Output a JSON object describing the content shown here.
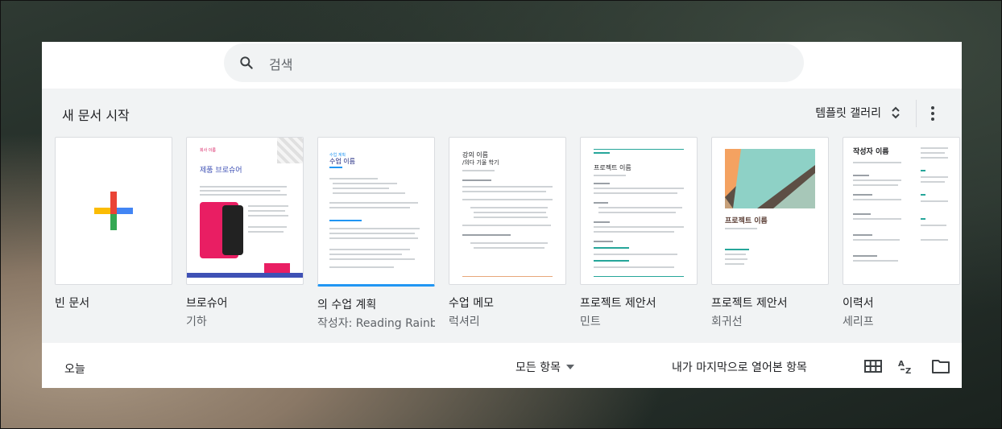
{
  "search": {
    "placeholder": "검색"
  },
  "gallery": {
    "title": "새 문서 시작",
    "toggle_label": "템플릿 갤러리",
    "templates": [
      {
        "name": "빈 문서",
        "sub": ""
      },
      {
        "name": "브로슈어",
        "sub": "기하",
        "thumb_title": "제품 브로슈어",
        "thumb_small": "회사 이름"
      },
      {
        "name": "의 수업 계획",
        "sub": "작성자: Reading Rainbow",
        "thumb_title": "수업 이름",
        "thumb_small": "수업 계획"
      },
      {
        "name": "수업 메모",
        "sub": "럭셔리",
        "thumb_title": "강의 이름",
        "thumb_small": "/의다 기울 학기"
      },
      {
        "name": "프로젝트 제안서",
        "sub": "민트",
        "thumb_title": "프로젝트 이름"
      },
      {
        "name": "프로젝트 제안서",
        "sub": "회귀선",
        "thumb_title": "프로젝트 이름"
      },
      {
        "name": "이력서",
        "sub": "세리프",
        "thumb_title": "작성자 이름"
      }
    ]
  },
  "footer": {
    "today": "오늘",
    "owner_filter": "모든 항목",
    "sort_label": "내가 마지막으로 열어본 항목"
  },
  "colors": {
    "accent_blue": "#4285f4",
    "accent_red": "#ea4335",
    "accent_yellow": "#fbbc04",
    "accent_green": "#34a853"
  }
}
